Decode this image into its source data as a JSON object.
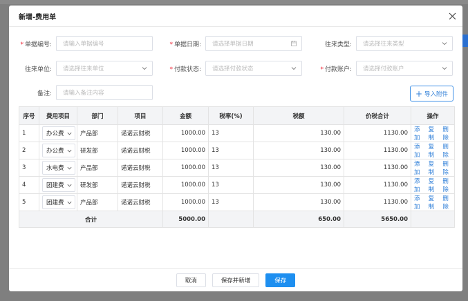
{
  "modal": {
    "title": "新增-费用单"
  },
  "form": {
    "doc_no": {
      "label": "单据编号:",
      "required": true,
      "placeholder": "请输入单据编号"
    },
    "doc_date": {
      "label": "单据日期:",
      "required": true,
      "placeholder": "请选择单据日期"
    },
    "partner_type": {
      "label": "往来类型:",
      "required": false,
      "placeholder": "请选择往来类型"
    },
    "partner_unit": {
      "label": "往来单位:",
      "required": false,
      "placeholder": "请选择往来单位"
    },
    "pay_status": {
      "label": "付款状态:",
      "required": true,
      "placeholder": "请选择付款状态"
    },
    "pay_account": {
      "label": "付款账户:",
      "required": true,
      "placeholder": "请选择付款账户"
    },
    "remark": {
      "label": "备注:",
      "required": false,
      "placeholder": "请输入备注内容"
    }
  },
  "import_button": "导入附件",
  "table": {
    "headers": [
      "序号",
      "费用项目",
      "部门",
      "项目",
      "金额",
      "税率(%)",
      "税额",
      "价税合计",
      "操作"
    ],
    "rows": [
      {
        "no": "1",
        "item": "办公费",
        "dept": "产品部",
        "project": "诺诺云财税",
        "amount": "1000.00",
        "rate": "13",
        "tax": "130.00",
        "total": "1130.00"
      },
      {
        "no": "2",
        "item": "办公费",
        "dept": "研发部",
        "project": "诺诺云财税",
        "amount": "1000.00",
        "rate": "13",
        "tax": "130.00",
        "total": "1130.00"
      },
      {
        "no": "3",
        "item": "水电费",
        "dept": "产品部",
        "project": "诺诺云财税",
        "amount": "1000.00",
        "rate": "13",
        "tax": "130.00",
        "total": "1130.00"
      },
      {
        "no": "4",
        "item": "团建费",
        "dept": "研发部",
        "project": "诺诺云财税",
        "amount": "1000.00",
        "rate": "13",
        "tax": "130.00",
        "total": "1130.00"
      },
      {
        "no": "5",
        "item": "团建费",
        "dept": "产品部",
        "project": "诺诺云财税",
        "amount": "1000.00",
        "rate": "13",
        "tax": "130.00",
        "total": "1130.00"
      }
    ],
    "ops": [
      "添加",
      "复制",
      "删除"
    ],
    "total_row": {
      "label": "合计",
      "amount": "5000.00",
      "tax": "650.00",
      "total": "5650.00"
    }
  },
  "footer": {
    "cancel": "取消",
    "save_new": "保存并新增",
    "save": "保存"
  },
  "colors": {
    "accent": "#1e8ff0",
    "link": "#2f7fd8",
    "required": "#ee2233"
  }
}
